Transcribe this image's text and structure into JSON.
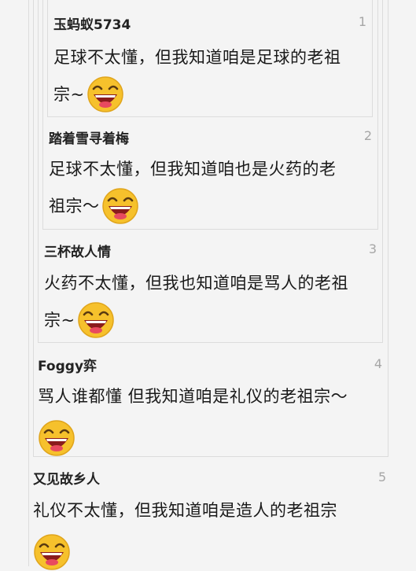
{
  "comments": [
    {
      "user": "玉蚂蚁5734",
      "floor": "1",
      "text_line1": "足球不太懂，但我知道咱是足球的老祖",
      "text_line2": "宗~",
      "emoji": "laughing-face-icon"
    },
    {
      "user": "踏着雪寻着梅",
      "floor": "2",
      "text_line1": "足球不太懂，但我知道咱也是火药的老",
      "text_line2": "祖宗～",
      "emoji": "laughing-face-icon"
    },
    {
      "user": "三杯故人情",
      "floor": "3",
      "text_line1": "火药不太懂，但我也知道咱是骂人的老祖",
      "text_line2": "宗~",
      "emoji": "laughing-face-icon"
    },
    {
      "user": "Foggy弈",
      "floor": "4",
      "text_line1": "骂人谁都懂 但我知道咱是礼仪的老祖宗～",
      "text_line2": "",
      "emoji": "laughing-face-icon"
    },
    {
      "user": "又见故乡人",
      "floor": "5",
      "text_line1": "礼仪不太懂，但我知道咱是造人的老祖宗",
      "text_line2": "",
      "emoji": "laughing-face-icon"
    }
  ],
  "colors": {
    "background": "#f4f4f4",
    "border": "#dcdcdc",
    "floor_number": "#a6a6a6",
    "emoji_face": "#f6c12c"
  }
}
